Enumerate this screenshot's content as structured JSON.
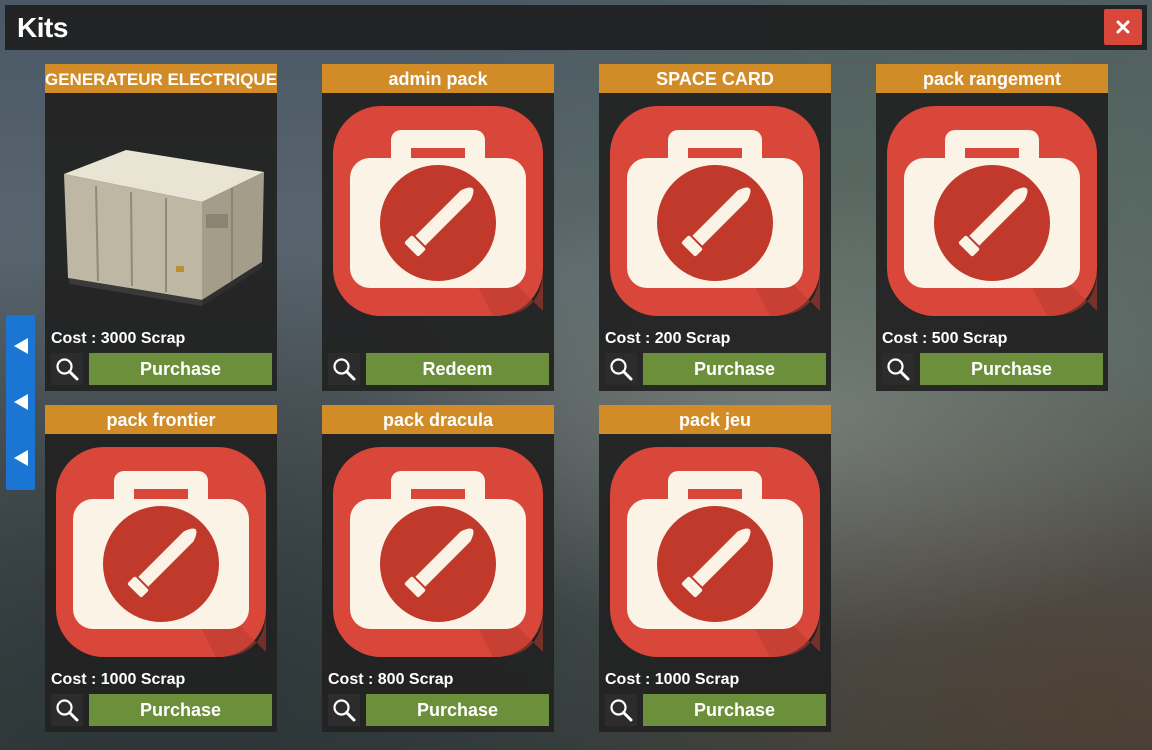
{
  "window": {
    "title": "Kits",
    "close_glyph": "×"
  },
  "colors": {
    "header": "#d18b27",
    "button": "#6b8f3a",
    "close": "#d9473a",
    "nav": "#1b76d3",
    "kit_icon_red": "#d9473a"
  },
  "side_nav": {
    "arrows": [
      "arrow-left-icon",
      "arrow-left-icon",
      "arrow-left-icon"
    ]
  },
  "kits": [
    {
      "name": "GENERATEUR ELECTRIQUE",
      "cost": "Cost : 3000 Scrap",
      "action": "Purchase",
      "icon": "generator-crate-image"
    },
    {
      "name": "admin pack",
      "cost": "",
      "action": "Redeem",
      "icon": "kit-bullet-icon"
    },
    {
      "name": "SPACE CARD",
      "cost": "Cost : 200 Scrap",
      "action": "Purchase",
      "icon": "kit-bullet-icon"
    },
    {
      "name": "pack rangement",
      "cost": "Cost : 500 Scrap",
      "action": "Purchase",
      "icon": "kit-bullet-icon"
    },
    {
      "name": "pack frontier",
      "cost": "Cost : 1000 Scrap",
      "action": "Purchase",
      "icon": "kit-bullet-icon"
    },
    {
      "name": "pack dracula",
      "cost": "Cost : 800 Scrap",
      "action": "Purchase",
      "icon": "kit-bullet-icon"
    },
    {
      "name": "pack jeu",
      "cost": "Cost : 1000 Scrap",
      "action": "Purchase",
      "icon": "kit-bullet-icon"
    }
  ]
}
